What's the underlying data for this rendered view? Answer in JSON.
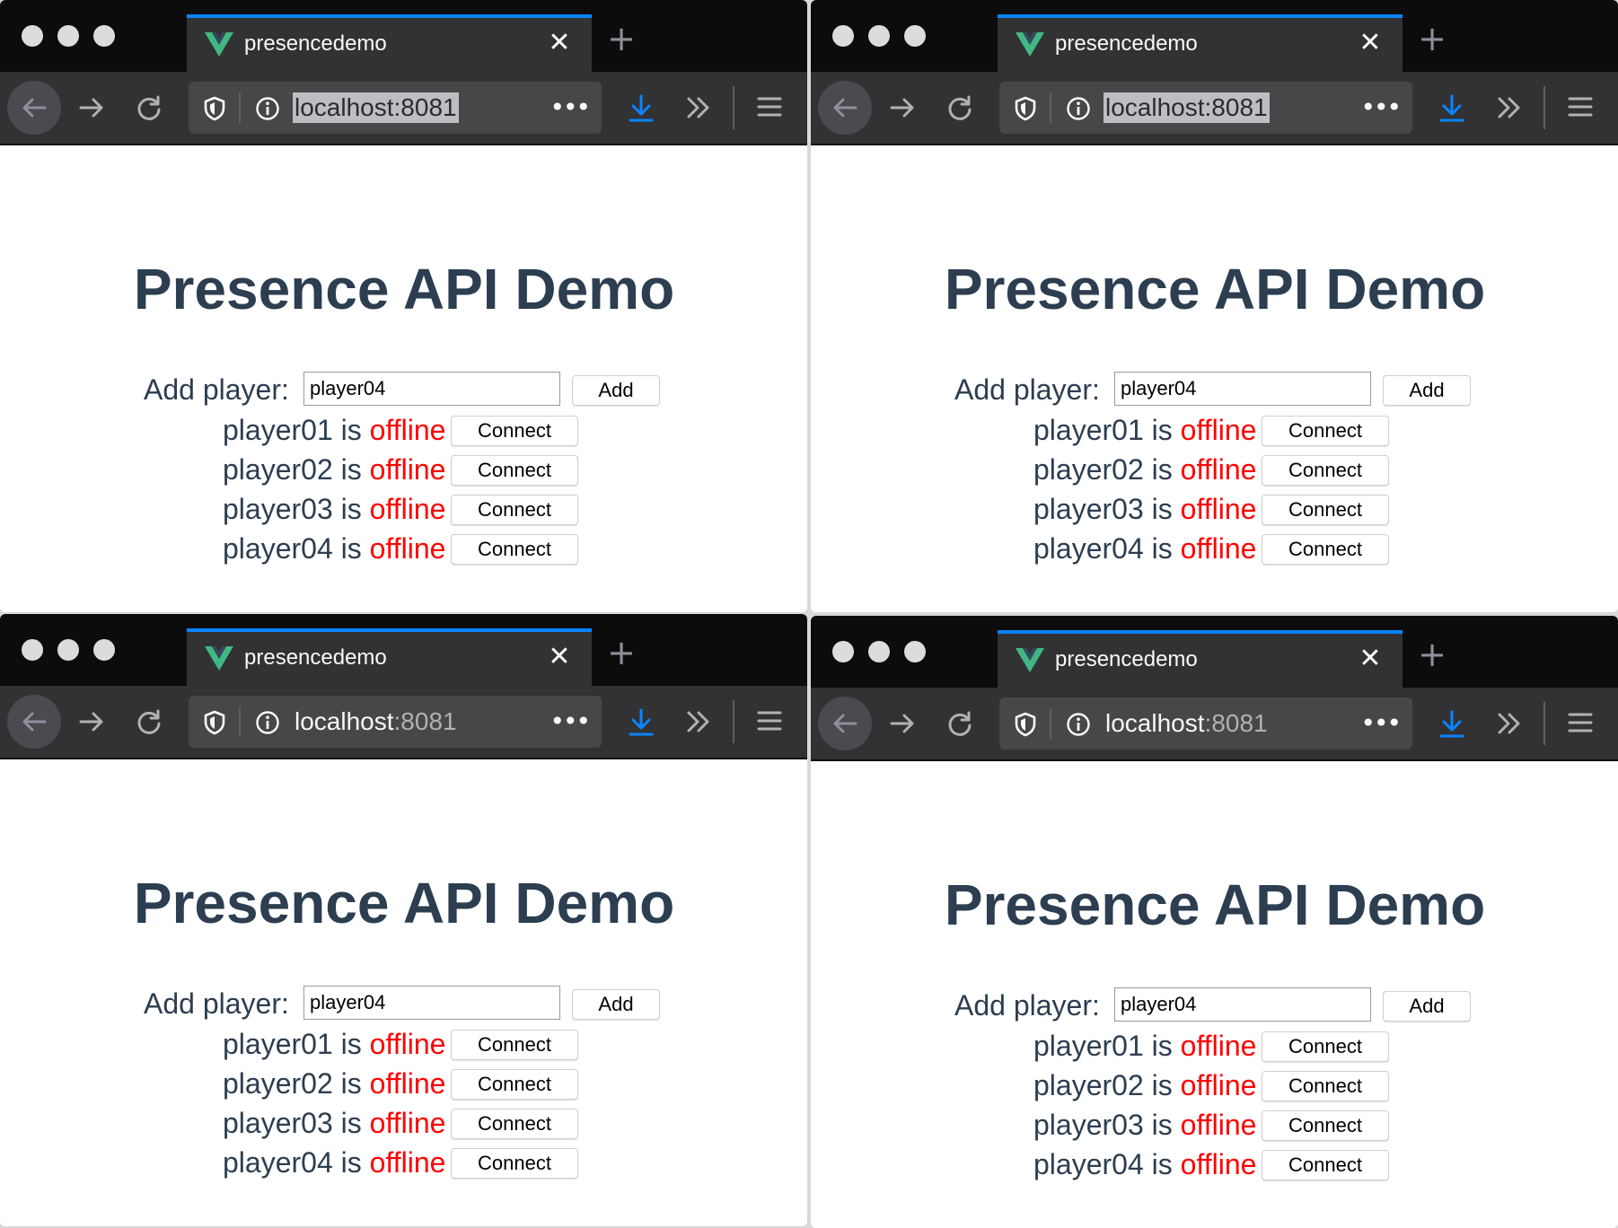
{
  "colors": {
    "tab_accent": "#0a84ff",
    "chrome_dark": "#0c0c0d",
    "toolbar": "#323234",
    "urlbar": "#474749",
    "heading_text": "#2c3e50",
    "offline_status": "#ff0000",
    "download_icon": "#0a84ff",
    "vue_logo_green": "#41b883",
    "vue_logo_dark": "#35495e"
  },
  "icons": {
    "favicon": "vue-logo-icon",
    "tab_close": "close-icon",
    "new_tab": "plus-icon",
    "back": "arrow-left-icon",
    "forward": "arrow-right-icon",
    "reload": "reload-icon",
    "tracking": "shield-icon",
    "site_info": "info-icon",
    "page_actions": "more-icon",
    "downloads": "download-icon",
    "overflow": "chevron-double-right-icon",
    "menu": "hamburger-menu-icon"
  },
  "windows": [
    {
      "tab": {
        "title": "presencedemo",
        "close_label": "✕"
      },
      "new_tab_label": "+",
      "url": {
        "host": "localhost",
        "port": ":8081",
        "selected": true
      },
      "page_actions_label": "•••",
      "page": {
        "heading": "Presence API Demo",
        "add_label": "Add player:",
        "add_input_value": "player04",
        "add_button": "Add",
        "players": [
          {
            "name": "player01",
            "is": "is",
            "status": "offline",
            "button": "Connect"
          },
          {
            "name": "player02",
            "is": "is",
            "status": "offline",
            "button": "Connect"
          },
          {
            "name": "player03",
            "is": "is",
            "status": "offline",
            "button": "Connect"
          },
          {
            "name": "player04",
            "is": "is",
            "status": "offline",
            "button": "Connect"
          }
        ]
      }
    },
    {
      "tab": {
        "title": "presencedemo",
        "close_label": "✕"
      },
      "new_tab_label": "+",
      "url": {
        "host": "localhost",
        "port": ":8081",
        "selected": true
      },
      "page_actions_label": "•••",
      "page": {
        "heading": "Presence API Demo",
        "add_label": "Add player:",
        "add_input_value": "player04",
        "add_button": "Add",
        "players": [
          {
            "name": "player01",
            "is": "is",
            "status": "offline",
            "button": "Connect"
          },
          {
            "name": "player02",
            "is": "is",
            "status": "offline",
            "button": "Connect"
          },
          {
            "name": "player03",
            "is": "is",
            "status": "offline",
            "button": "Connect"
          },
          {
            "name": "player04",
            "is": "is",
            "status": "offline",
            "button": "Connect"
          }
        ]
      }
    },
    {
      "tab": {
        "title": "presencedemo",
        "close_label": "✕"
      },
      "new_tab_label": "+",
      "url": {
        "host": "localhost",
        "port": ":8081",
        "selected": false
      },
      "page_actions_label": "•••",
      "page": {
        "heading": "Presence API Demo",
        "add_label": "Add player:",
        "add_input_value": "player04",
        "add_button": "Add",
        "players": [
          {
            "name": "player01",
            "is": "is",
            "status": "offline",
            "button": "Connect"
          },
          {
            "name": "player02",
            "is": "is",
            "status": "offline",
            "button": "Connect"
          },
          {
            "name": "player03",
            "is": "is",
            "status": "offline",
            "button": "Connect"
          },
          {
            "name": "player04",
            "is": "is",
            "status": "offline",
            "button": "Connect"
          }
        ]
      }
    },
    {
      "tab": {
        "title": "presencedemo",
        "close_label": "✕"
      },
      "new_tab_label": "+",
      "url": {
        "host": "localhost",
        "port": ":8081",
        "selected": false
      },
      "page_actions_label": "•••",
      "page": {
        "heading": "Presence API Demo",
        "add_label": "Add player:",
        "add_input_value": "player04",
        "add_button": "Add",
        "players": [
          {
            "name": "player01",
            "is": "is",
            "status": "offline",
            "button": "Connect"
          },
          {
            "name": "player02",
            "is": "is",
            "status": "offline",
            "button": "Connect"
          },
          {
            "name": "player03",
            "is": "is",
            "status": "offline",
            "button": "Connect"
          },
          {
            "name": "player04",
            "is": "is",
            "status": "offline",
            "button": "Connect"
          }
        ]
      }
    }
  ]
}
